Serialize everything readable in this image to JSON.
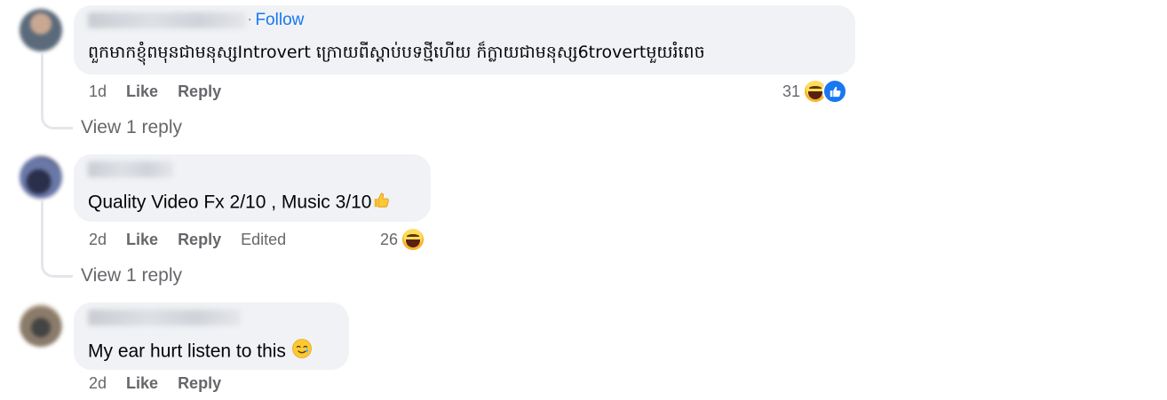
{
  "comments": [
    {
      "follow_label": "Follow",
      "separator": "·",
      "text": "ពួកមាកខ្ញុំពមុនជាមនុស្សIntrovert ក្រោយពីស្តាប់បទថ្មីហើយ ក៏ក្លាយជាមនុស្ស6trovertមួយរំពេច",
      "time": "1d",
      "like_label": "Like",
      "reply_label": "Reply",
      "reaction_count": "31",
      "view_replies": "View 1 reply"
    },
    {
      "text": "Quality Video Fx 2/10 , Music 3/10",
      "time": "2d",
      "like_label": "Like",
      "reply_label": "Reply",
      "edited_label": "Edited",
      "reaction_count": "26",
      "view_replies": "View 1 reply"
    },
    {
      "text": "My ear hurt listen to this",
      "time": "2d",
      "like_label": "Like",
      "reply_label": "Reply"
    }
  ],
  "icons": {
    "haha": "haha-reaction-icon",
    "like": "like-reaction-icon",
    "thumbs_up": "thumbs-up-emoji",
    "crying_smile": "smiling-tear-emoji"
  },
  "colors": {
    "bubble": "#f0f2f5",
    "link_blue": "#1877f2",
    "meta_gray": "#65676b",
    "text": "#050505"
  }
}
